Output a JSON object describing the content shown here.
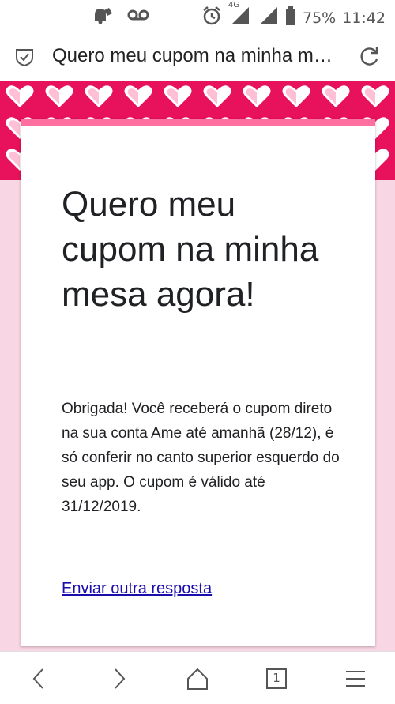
{
  "status_bar": {
    "left_icons": [
      "notification-icon",
      "voicemail-icon"
    ],
    "right_icons": [
      "alarm-icon",
      "signal-4g-icon",
      "signal-icon",
      "battery-icon"
    ],
    "network_label": "4G",
    "battery_percent": "75%",
    "time": "11:42"
  },
  "address_bar": {
    "title": "Quero meu cupom na minha m…"
  },
  "card": {
    "title": "Quero meu cupom na minha mesa agora!",
    "message": "Obrigada! Você receberá o cupom direto na sua conta Ame até amanhã (28/12), é só conferir no canto superior esquerdo do seu app. O cupom é válido até 31/12/2019.",
    "link_label": "Enviar outra resposta"
  },
  "nav": {
    "tab_count": "1"
  },
  "colors": {
    "hero_pink": "#e8115c",
    "card_accent": "#ff6fa0",
    "page_bg": "#f9d6e4",
    "link": "#1a0dab"
  }
}
